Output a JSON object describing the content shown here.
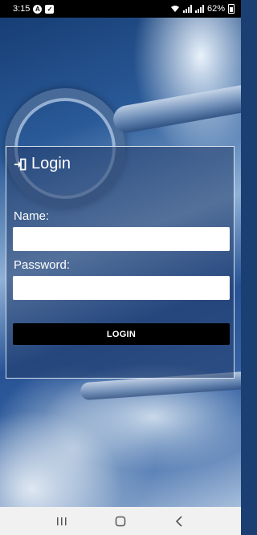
{
  "status_bar": {
    "time": "3:15",
    "notification_icons": [
      "app-a-icon",
      "checkbox-icon"
    ],
    "battery_percent": "62%"
  },
  "login": {
    "title": "Login",
    "title_icon": "login-icon",
    "name_label": "Name:",
    "name_value": "",
    "password_label": "Password:",
    "password_value": "",
    "button_label": "LOGIN"
  },
  "nav_bar": {
    "buttons": [
      "recent-apps-icon",
      "home-icon",
      "back-icon"
    ]
  },
  "colors": {
    "button_background": "#000000",
    "panel_border": "#d7e1ee"
  }
}
